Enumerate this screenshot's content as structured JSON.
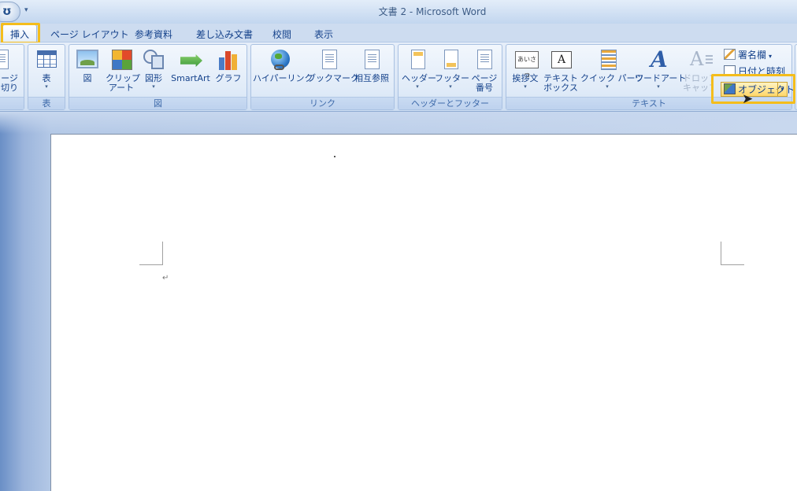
{
  "title_bar": {
    "office_button_glyph": "ʊ",
    "qat_arrow": "▾",
    "title": "文書 2 - Microsoft Word"
  },
  "tabs": [
    {
      "label": "挿入",
      "active": true
    },
    {
      "label": "ページ レイアウト"
    },
    {
      "label": "参考資料"
    },
    {
      "label": "差し込み文書"
    },
    {
      "label": "校閲"
    },
    {
      "label": "表示"
    }
  ],
  "ribbon": {
    "pages_group": {
      "label_top": "ージ",
      "label_bottom": "切り"
    },
    "table_group": {
      "name": "表",
      "button": "表"
    },
    "illustrations_group": {
      "name": "図",
      "buttons": [
        "図",
        "クリップ\nアート",
        "図形",
        "SmartArt",
        "グラフ"
      ]
    },
    "links_group": {
      "name": "リンク",
      "buttons": [
        "ハイパーリンク",
        "ブックマーク",
        "相互参照"
      ]
    },
    "header_footer_group": {
      "name": "ヘッダーとフッター",
      "buttons": [
        "ヘッダー",
        "フッター",
        "ページ\n番号"
      ]
    },
    "text_group": {
      "name": "テキスト",
      "buttons": [
        "挨拶文",
        "テキスト\nボックス",
        "クイック パーツ",
        "ワードアート",
        "ドロップ\nキャップ"
      ],
      "greeting_icon_text": "あいさつ",
      "textbox_icon_text": "A",
      "wordart_icon_text": "A",
      "drop_icon_text": "A≡",
      "small_buttons": [
        "署名欄",
        "日付と時刻",
        "オブジェクト"
      ]
    }
  },
  "document": {
    "paragraph_mark": "↵"
  },
  "colors": {
    "highlight": "#f4bd1c",
    "ribbon_text": "#15428b"
  },
  "icons": [
    "office-button-icon",
    "pointer-cursor-icon"
  ]
}
